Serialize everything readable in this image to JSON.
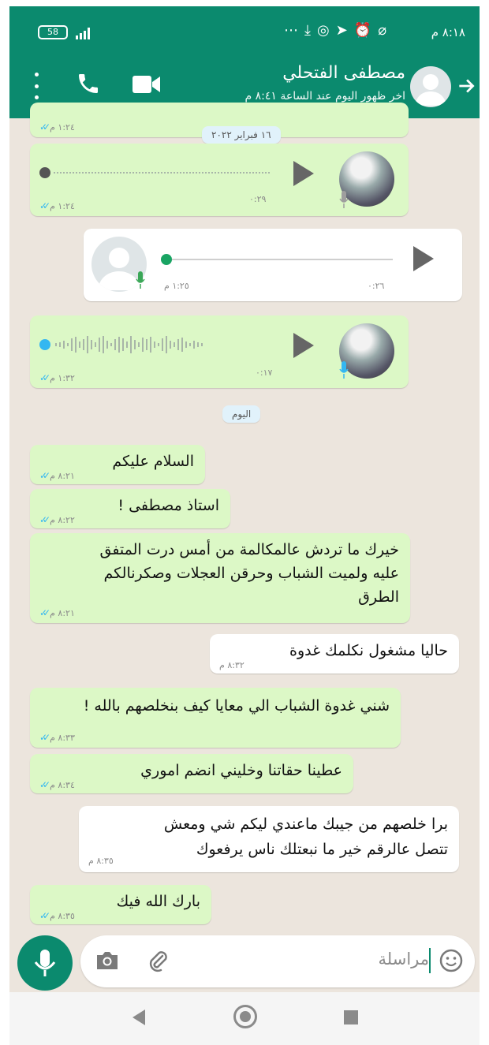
{
  "status_bar": {
    "time": "٨:١٨ م",
    "battery": "58",
    "icons": [
      "battery-icon",
      "signal-icon",
      "more-dots-icon",
      "download-icon",
      "whatsapp-icon",
      "telegram-icon",
      "alarm-icon",
      "wifi-off-icon"
    ]
  },
  "header": {
    "contact_name": "مصطفى الفتحلي",
    "last_seen": "اخر ظهور اليوم عند الساعة ٨:٤١ م",
    "icons": [
      "back-arrow-icon",
      "avatar-placeholder-icon",
      "video-call-icon",
      "phone-icon",
      "menu-dots-icon"
    ]
  },
  "date_pills": {
    "feb": "١٦ فبراير ٢٠٢٢",
    "today": "اليوم"
  },
  "voice_messages": [
    {
      "direction": "out",
      "duration": "٠:٢٩",
      "time": "١:٢٤ م",
      "partial_time": "١:٢٤ م"
    },
    {
      "direction": "in",
      "duration": "٠:٢٦",
      "time": "١:٢٥ م"
    },
    {
      "direction": "out",
      "duration": "٠:١٧",
      "time": "١:٣٢ م"
    }
  ],
  "text_messages": [
    {
      "direction": "out",
      "lines": [
        "السلام عليكم"
      ],
      "time": "٨:٢١ م"
    },
    {
      "direction": "out",
      "lines": [
        "استاذ مصطفى !"
      ],
      "time": "٨:٢٢ م"
    },
    {
      "direction": "out",
      "lines": [
        "خيرك ما تردش عالمكالمة من أمس درت المتفق",
        "عليه ولميت الشباب وحرقن العجلات وصكرنالكم",
        "الطرق"
      ],
      "time": "٨:٢١ م"
    },
    {
      "direction": "in",
      "lines": [
        "حاليا مشغول نكلمك غدوة"
      ],
      "time": "٨:٣٢ م"
    },
    {
      "direction": "out",
      "lines": [
        "شني غدوة الشباب الي معايا كيف بنخلصهم بالله !"
      ],
      "time": "٨:٣٣ م"
    },
    {
      "direction": "out",
      "lines": [
        "عطينا حقاتنا وخليني انضم اموري"
      ],
      "time": "٨:٣٤ م"
    },
    {
      "direction": "in",
      "lines": [
        "برا خلصهم من جيبك ماعندي ليكم شي ومعش",
        "تتصل عالرقم خير ما نبعتلك ناس يرفعوك"
      ],
      "time": "٨:٣٥ م"
    },
    {
      "direction": "out",
      "lines": [
        "بارك الله فيك"
      ],
      "time": "٨:٣٥ م"
    }
  ],
  "input": {
    "placeholder": "مراسلة",
    "icons": [
      "emoji-icon",
      "attach-icon",
      "camera-icon",
      "mic-icon"
    ]
  },
  "nav": {
    "icons": [
      "back-nav-icon",
      "home-nav-icon",
      "recents-nav-icon"
    ]
  },
  "colors": {
    "brand": "#0b8a6e",
    "outgoing": "#dcf8c6",
    "incoming": "#ffffff",
    "background": "#ece5dd",
    "read_ticks": "#34b7f1"
  }
}
